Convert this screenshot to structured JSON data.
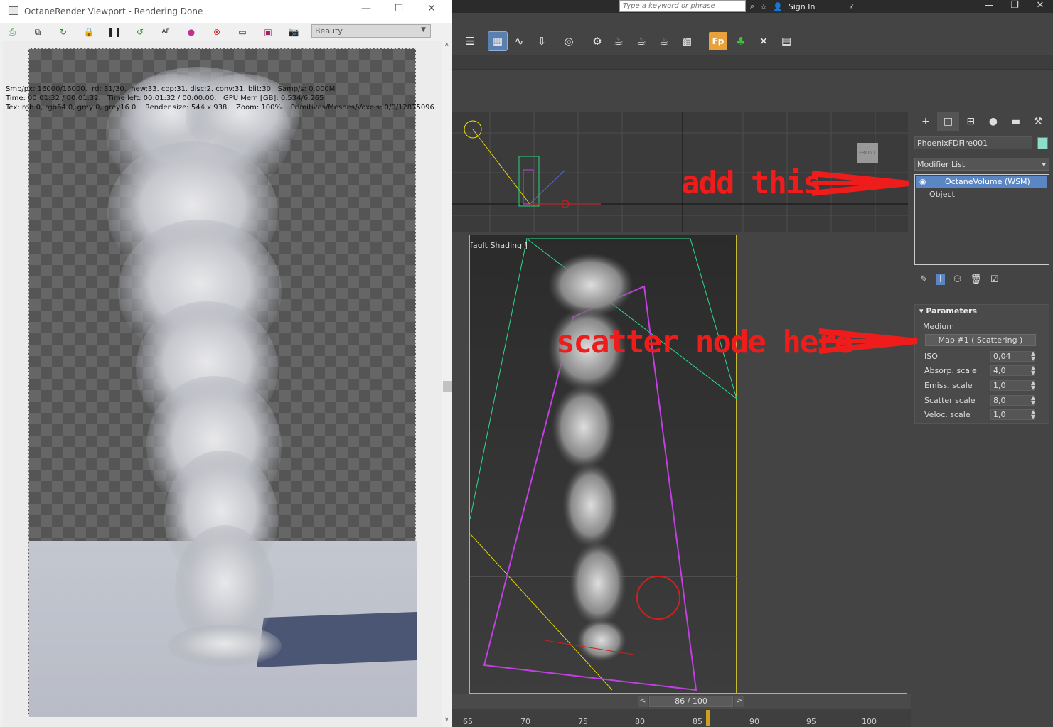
{
  "octane": {
    "title": "OctaneRender Viewport - Rendering Done",
    "min": "—",
    "max": "☐",
    "close": "✕",
    "channel": "Beauty",
    "stats_line1": "Smp/px: 16000/16000.  rd: 31/30.  new:33. cop:31. disc:2. conv:31. blit:30.  Samp/s: 0.000M",
    "stats_line2": "Time: 00:01:32 / 00:01:32.   Time left: 00:01:32 / 00:00:00.   GPU Mem [GB]: 0.534/6.265",
    "stats_line3": "Tex: rgb 0, rgb64 0, grey 0, grey16 0.   Render size: 544 x 938.   Zoom: 100%.   Primitives/Meshes/Voxels: 0/0/12875096"
  },
  "max": {
    "search_placeholder": "Type a keyword or phrase",
    "sign_in": "Sign In",
    "viewport_label": "fault Shading ]",
    "time_display": "86 / 100",
    "ticks": [
      "65",
      "70",
      "75",
      "80",
      "85",
      "90",
      "95",
      "100"
    ],
    "nav_prev": "<",
    "nav_next": ">"
  },
  "cmdpanel": {
    "object_name": "PhoenixFDFire001",
    "object_color": "#8fdcc8",
    "modifier_list": "Modifier List",
    "stack_selected": "OctaneVolume (WSM)",
    "stack_object": "Object",
    "params_title": "Parameters",
    "medium_label": "Medium",
    "map_button": "Map #1  ( Scattering )",
    "params": [
      {
        "label": "ISO",
        "value": "0,04"
      },
      {
        "label": "Absorp. scale",
        "value": "4,0"
      },
      {
        "label": "Emiss. scale",
        "value": "1,0"
      },
      {
        "label": "Scatter scale",
        "value": "8,0"
      },
      {
        "label": "Veloc. scale",
        "value": "1,0"
      }
    ]
  },
  "annotations": {
    "add_this": "add this",
    "scatter_here": "scatter node here"
  },
  "colors": {
    "annotation": "#ef1c1c",
    "selection": "#5b86c4",
    "viewport_border": "#c9b92a"
  }
}
